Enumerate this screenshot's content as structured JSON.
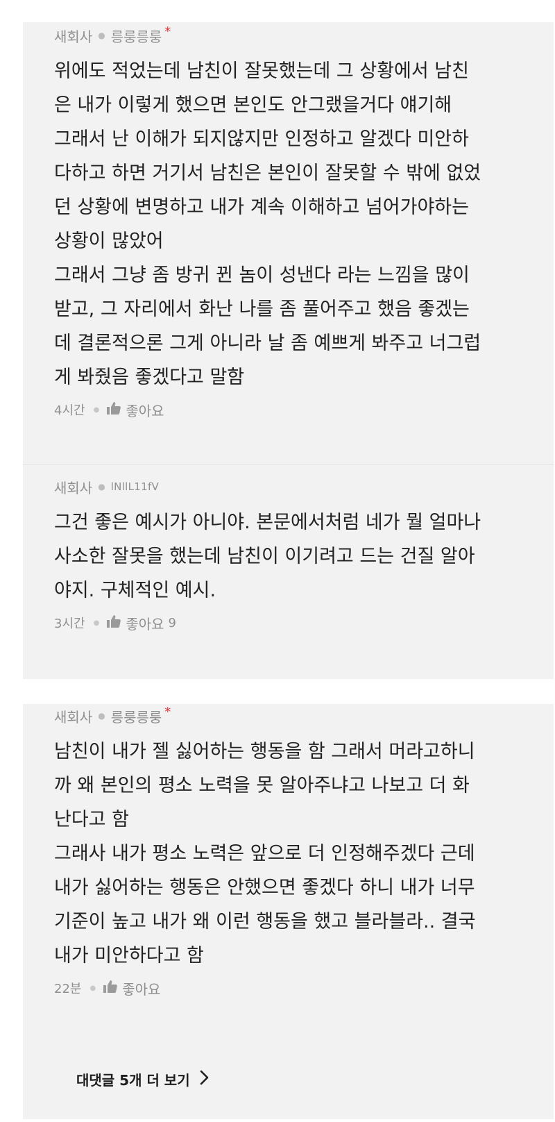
{
  "comments": [
    {
      "author_group": "새회사",
      "author_nick": "릉룽릉룽",
      "is_author": true,
      "author_mark": "*",
      "text": "위에도 적었는데 남친이 잘못했는데 그 상황에서 남친\n은 내가 이렇게 했으면 본인도 안그랬을거다 얘기해\n그래서 난 이해가 되지않지만 인정하고 알겠다 미안하\n다하고 하면 거기서 남친은 본인이 잘못할 수 밖에 없었\n던 상황에 변명하고 내가 계속 이해하고 넘어가야하는\n상황이 많았어\n그래서 그냥 좀 방귀 뀐 놈이 성낸다 라는 느낌을 많이\n받고, 그 자리에서 화난 나를 좀 풀어주고 했음 좋겠는\n데 결론적으론 그게 아니라 날 좀 예쁘게 봐주고 너그럽\n게 봐줬음 좋겠다고 말함",
      "time": "4시간",
      "like_label": "좋아요",
      "like_count": ""
    },
    {
      "author_group": "새회사",
      "author_nick": "lNllL11fV",
      "is_author": false,
      "author_mark": "",
      "text": "그건 좋은 예시가 아니야. 본문에서처럼 네가 뭘 얼마나\n사소한 잘못을 했는데 남친이 이기려고 드는 건질 알아\n야지. 구체적인 예시.",
      "time": "3시간",
      "like_label": "좋아요",
      "like_count": "9"
    },
    {
      "author_group": "새회사",
      "author_nick": "릉룽릉룽",
      "is_author": true,
      "author_mark": "*",
      "text": "남친이 내가 젤 싫어하는 행동을 함 그래서 머라고하니\n까 왜 본인의 평소 노력을 못 알아주냐고 나보고 더 화\n난다고 함\n그래사 내가 평소 노력은 앞으로 더 인정해주겠다 근데\n내가 싫어하는 행동은 안했으면 좋겠다 하니 내가 너무\n기준이 높고 내가 왜 이런 행동을 했고 블라블라.. 결국\n내가 미안하다고 함",
      "time": "22분",
      "like_label": "좋아요",
      "like_count": ""
    }
  ],
  "more_replies_label": "대댓글 5개 더 보기",
  "icons": {
    "like": "thumbs-up-icon",
    "more": "chevron-right-icon"
  },
  "colors": {
    "card_bg": "#f2f2f2",
    "text": "#222222",
    "meta": "#8f8f8f",
    "author_mark": "#e0323c"
  }
}
